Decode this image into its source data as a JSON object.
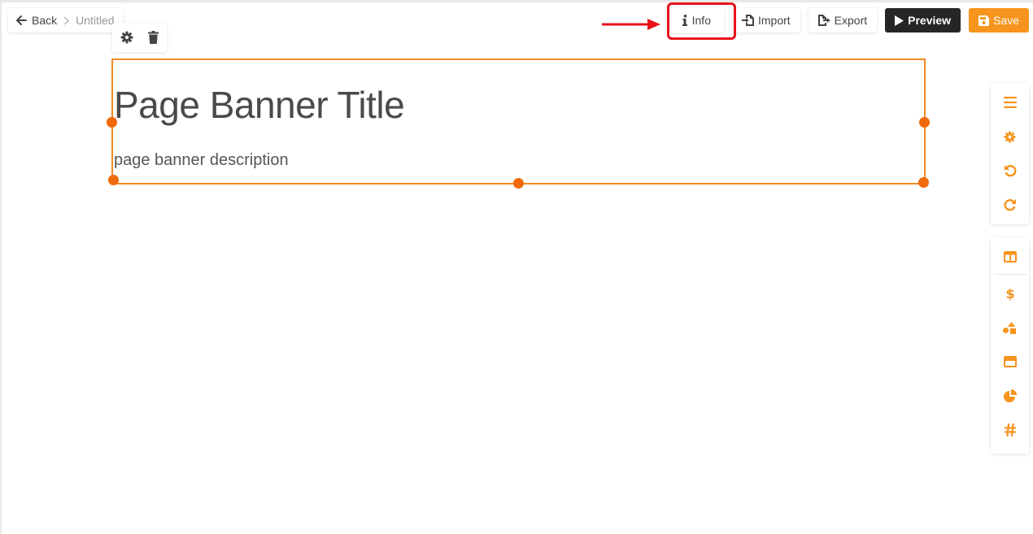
{
  "colors": {
    "accent": "#f7941d",
    "handle": "#f06a0a",
    "highlight": "#e8111a",
    "preview_bg": "#262626"
  },
  "breadcrumb": {
    "back_label": "Back",
    "current": "Untitled"
  },
  "toolbar": {
    "info_label": "Info",
    "import_label": "Import",
    "export_label": "Export",
    "preview_label": "Preview",
    "save_label": "Save"
  },
  "block_tools": {
    "icons": [
      "gear-icon",
      "trash-icon"
    ]
  },
  "banner": {
    "title": "Page Banner Title",
    "description": "page banner description"
  },
  "side_panel": {
    "group1": [
      "menu-icon",
      "gear-icon",
      "undo-icon",
      "redo-icon"
    ],
    "group2": [
      "columns-icon",
      "dollar-icon",
      "shapes-icon",
      "card-icon",
      "pie-chart-icon",
      "hash-icon"
    ]
  }
}
